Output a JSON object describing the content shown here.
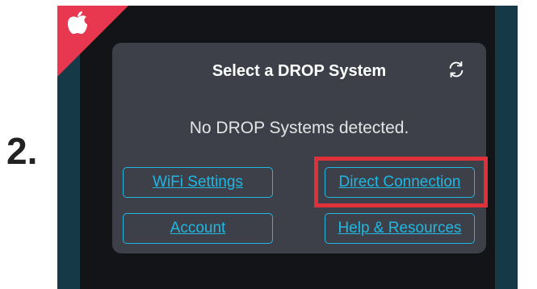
{
  "step": {
    "number": "2."
  },
  "dialog": {
    "title": "Select a DROP System",
    "status": "No DROP Systems detected.",
    "buttons": {
      "wifi": "WiFi Settings",
      "direct": "Direct Connection",
      "account": "Account",
      "help": "Help & Resources"
    }
  },
  "icons": {
    "corner_badge": "apple-icon",
    "refresh": "refresh-icon"
  },
  "colors": {
    "accent": "#20b7e2",
    "highlight": "#e0303a",
    "corner_badge": "#e8384f",
    "dialog_bg": "#3d4049",
    "side_panel": "#163947"
  }
}
